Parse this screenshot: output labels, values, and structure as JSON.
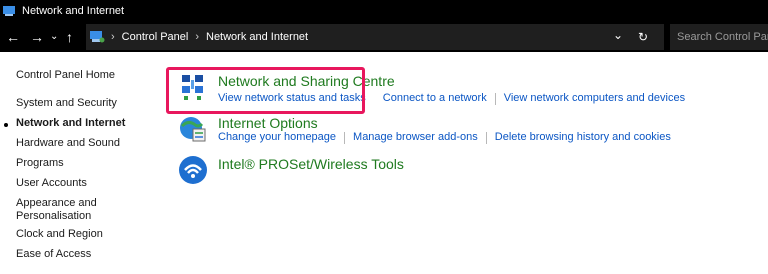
{
  "window": {
    "title": "Network and Internet"
  },
  "navigation": {
    "back_icon": "back-arrow-icon",
    "forward_icon": "forward-arrow-icon",
    "recent_icon": "chevron-down-icon",
    "up_icon": "up-arrow-icon",
    "breadcrumb": [
      "Control Panel",
      "Network and Internet"
    ],
    "breadcrumb_separator": "›",
    "dropdown_glyph": "⌄",
    "refresh_glyph": "↻",
    "search_placeholder": "Search Control Panel"
  },
  "sidebar": {
    "items": [
      {
        "label": "Control Panel Home"
      },
      {
        "label": "System and Security"
      },
      {
        "label": "Network and Internet",
        "active": true
      },
      {
        "label": "Hardware and Sound"
      },
      {
        "label": "Programs"
      },
      {
        "label": "User Accounts"
      },
      {
        "label": "Appearance and"
      },
      {
        "label": "Personalisation"
      },
      {
        "label": "Clock and Region"
      },
      {
        "label": "Ease of Access"
      }
    ]
  },
  "categories": [
    {
      "title": "Network and Sharing Centre",
      "icon": "network-sharing-icon",
      "links": [
        "View network status and tasks",
        "Connect to a network",
        "View network computers and devices"
      ]
    },
    {
      "title": "Internet Options",
      "icon": "internet-options-icon",
      "links": [
        "Change your homepage",
        "Manage browser add-ons",
        "Delete browsing history and cookies"
      ]
    },
    {
      "title": "Intel® PROSet/Wireless Tools",
      "icon": "wireless-icon",
      "links": []
    }
  ],
  "colors": {
    "title_green": "#1f7a1f",
    "link_blue": "#0b56c4",
    "highlight": "#e8175d",
    "chrome": "#000000"
  }
}
